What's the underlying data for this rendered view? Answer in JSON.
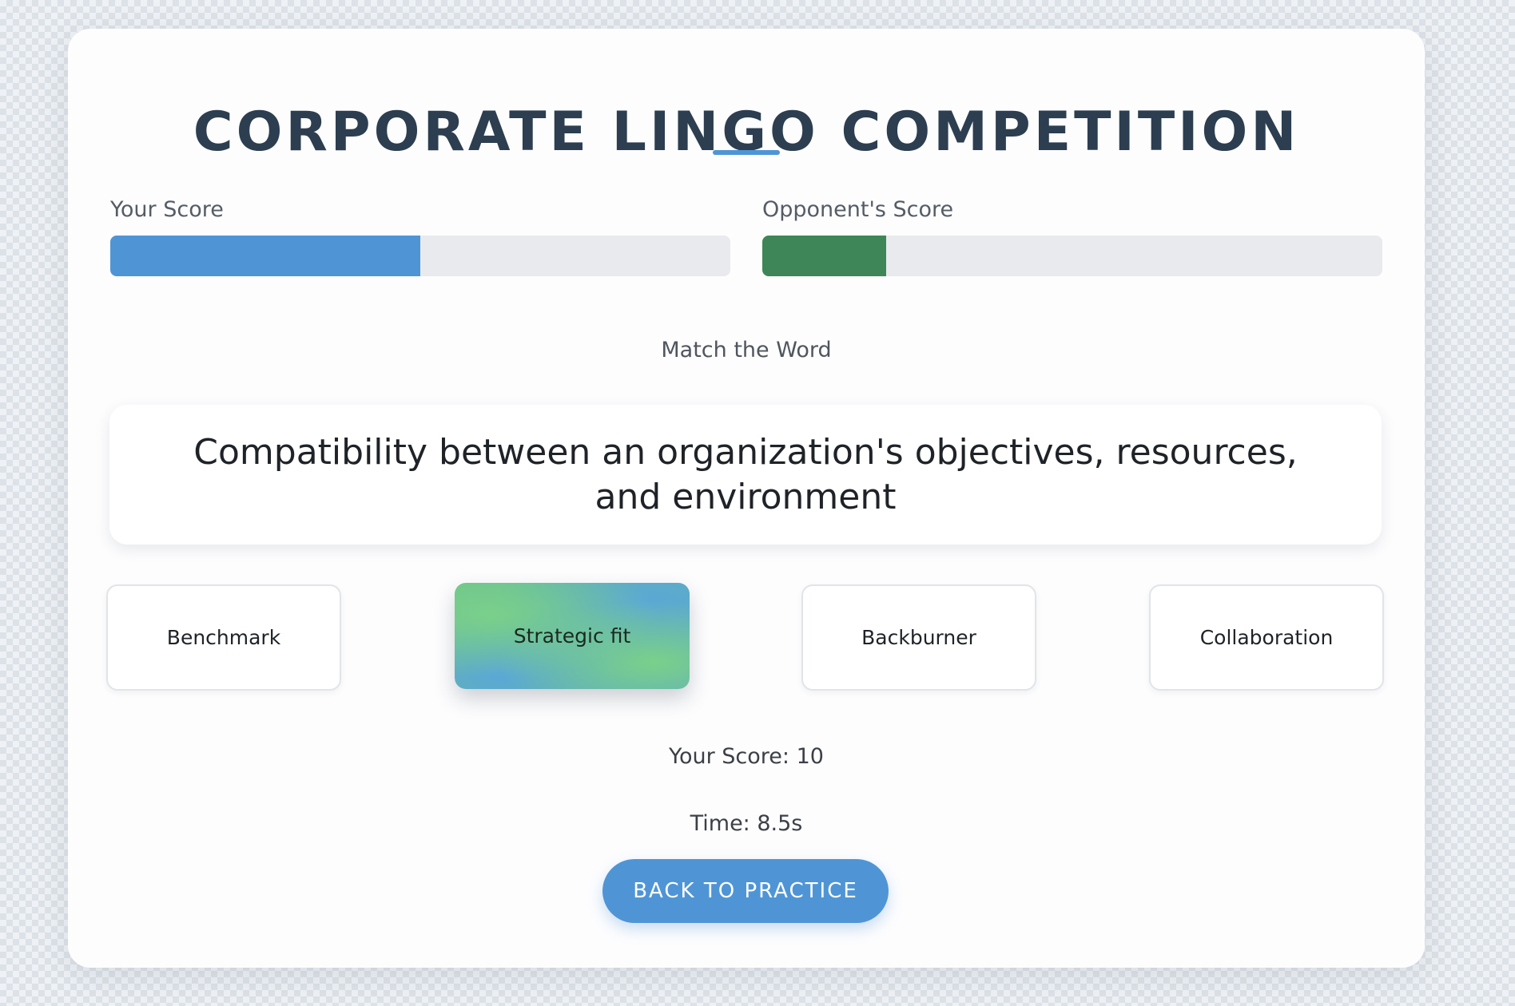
{
  "header": {
    "title": "CORPORATE LINGO COMPETITION"
  },
  "scores": {
    "player": {
      "label": "Your Score",
      "progress_percent": 50,
      "color": "#4f95d6"
    },
    "opponent": {
      "label": "Opponent's Score",
      "progress_percent": 20,
      "color": "#3e8657"
    }
  },
  "question": {
    "instruction": "Match the Word",
    "definition": "Compatibility between an organization's objectives, resources, and environment"
  },
  "options": [
    {
      "label": "Benchmark",
      "selected": false
    },
    {
      "label": "Strategic fit",
      "selected": true
    },
    {
      "label": "Backburner",
      "selected": false
    },
    {
      "label": "Collaboration",
      "selected": false
    }
  ],
  "status": {
    "score_text": "Your Score: 10",
    "time_text": "Time: 8.5s"
  },
  "actions": {
    "back_label": "BACK TO PRACTICE"
  },
  "colors": {
    "accent": "#4f95d6",
    "opponent": "#3e8657",
    "title": "#2c3e50"
  }
}
